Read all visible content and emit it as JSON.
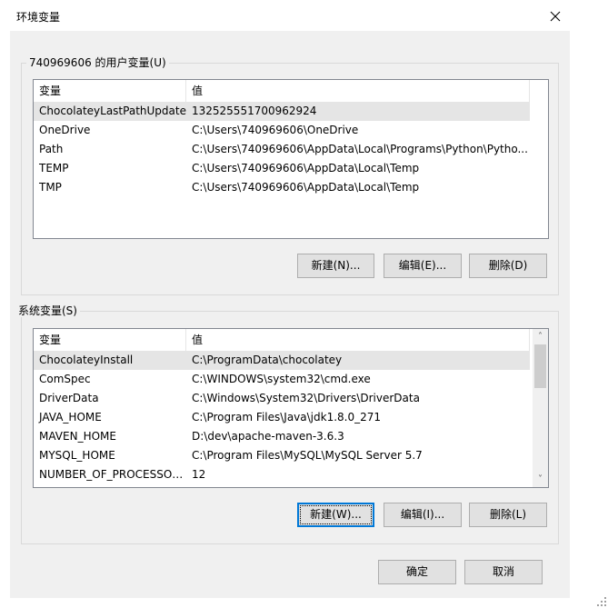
{
  "window": {
    "title": "环境变量",
    "close_icon": "close-icon"
  },
  "user_vars": {
    "group_label": "740969606 的用户变量(U)",
    "columns": [
      "变量",
      "值"
    ],
    "rows": [
      {
        "name": "ChocolateyLastPathUpdate",
        "value": "132525551700962924"
      },
      {
        "name": "OneDrive",
        "value": "C:\\Users\\740969606\\OneDrive"
      },
      {
        "name": "Path",
        "value": "C:\\Users\\740969606\\AppData\\Local\\Programs\\Python\\Pytho..."
      },
      {
        "name": "TEMP",
        "value": "C:\\Users\\740969606\\AppData\\Local\\Temp"
      },
      {
        "name": "TMP",
        "value": "C:\\Users\\740969606\\AppData\\Local\\Temp"
      }
    ],
    "selected_row": 0,
    "buttons": {
      "new": "新建(N)...",
      "edit": "编辑(E)...",
      "delete": "删除(D)"
    }
  },
  "system_vars": {
    "group_label": "系统变量(S)",
    "columns": [
      "变量",
      "值"
    ],
    "rows": [
      {
        "name": "ChocolateyInstall",
        "value": "C:\\ProgramData\\chocolatey"
      },
      {
        "name": "ComSpec",
        "value": "C:\\WINDOWS\\system32\\cmd.exe"
      },
      {
        "name": "DriverData",
        "value": "C:\\Windows\\System32\\Drivers\\DriverData"
      },
      {
        "name": "JAVA_HOME",
        "value": "C:\\Program Files\\Java\\jdk1.8.0_271"
      },
      {
        "name": "MAVEN_HOME",
        "value": "D:\\dev\\apache-maven-3.6.3"
      },
      {
        "name": "MYSQL_HOME",
        "value": "C:\\Program Files\\MySQL\\MySQL Server 5.7"
      },
      {
        "name": "NUMBER_OF_PROCESSORS",
        "value": "12"
      }
    ],
    "selected_row": 0,
    "buttons": {
      "new": "新建(W)...",
      "edit": "编辑(I)...",
      "delete": "删除(L)"
    }
  },
  "dialog_buttons": {
    "ok": "确定",
    "cancel": "取消"
  }
}
